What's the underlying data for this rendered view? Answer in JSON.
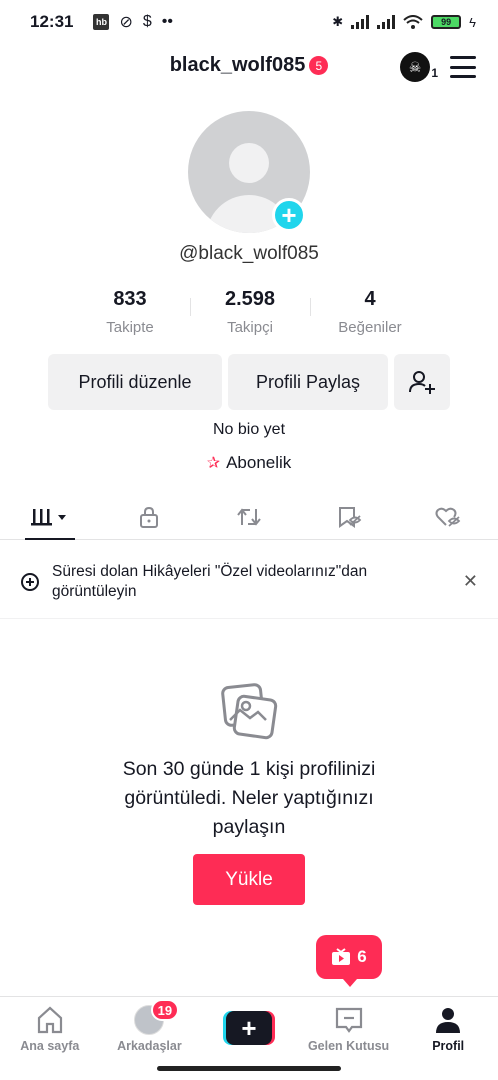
{
  "status_bar": {
    "time": "12:31",
    "battery": "99",
    "app_badge": "hb"
  },
  "header": {
    "username": "black_wolf085",
    "notification_count": "5",
    "creator_count": "1"
  },
  "profile": {
    "handle": "@black_wolf085",
    "stats": [
      {
        "value": "833",
        "label": "Takipte"
      },
      {
        "value": "2.598",
        "label": "Takipçi"
      },
      {
        "value": "4",
        "label": "Beğeniler"
      }
    ],
    "edit_button": "Profili düzenle",
    "share_button": "Profili Paylaş",
    "bio": "No bio yet",
    "subscription": "Abonelik"
  },
  "banner": {
    "text": "Süresi dolan Hikâyeleri \"Özel videolarınız\"dan görüntüleyin"
  },
  "empty_state": {
    "message": "Son 30 günde 1 kişi profilinizi görüntüledi. Neler yaptığınızı paylaşın",
    "upload_button": "Yükle"
  },
  "live_badge": {
    "count": "6"
  },
  "bottom_nav": {
    "home": "Ana sayfa",
    "friends": "Arkadaşlar",
    "friends_badge": "19",
    "inbox": "Gelen Kutusu",
    "profile": "Profil"
  },
  "colors": {
    "accent": "#fe2c55",
    "cyan": "#20d5ec",
    "text": "#161823",
    "muted": "#8a8b91"
  }
}
